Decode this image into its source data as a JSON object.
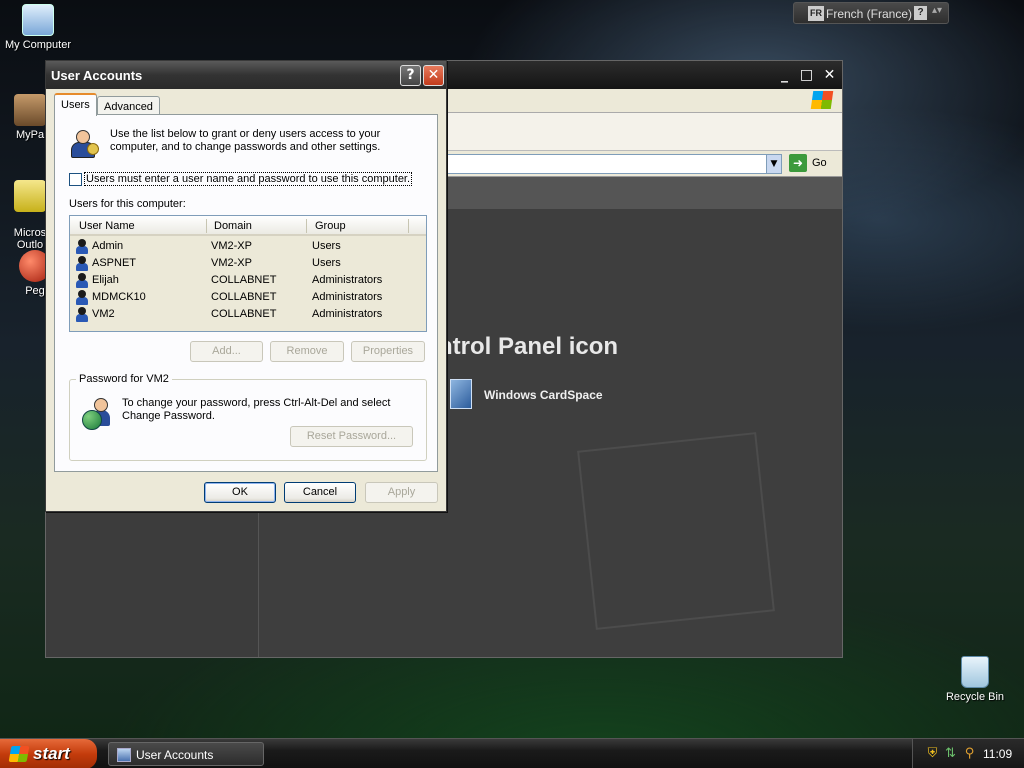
{
  "desktop": {
    "icons": [
      {
        "label": "My Computer"
      },
      {
        "label": "MyPa"
      },
      {
        "label": "Micros\nOutlo"
      },
      {
        "label": "Peg"
      }
    ],
    "recycle_bin": "Recycle Bin"
  },
  "language_bar": {
    "code": "FR",
    "language": "French (France)",
    "help": "?"
  },
  "control_panel": {
    "go_label": "Go",
    "heading": "ntrol Panel icon",
    "item": "Windows CardSpace"
  },
  "dialog": {
    "title": "User Accounts",
    "help_button": "?",
    "close_button": "✕",
    "tabs": [
      "Users",
      "Advanced"
    ],
    "intro": "Use the list below to grant or deny users access to your computer, and to change passwords and other settings.",
    "checkbox_label": "Users must enter a user name and password to use this computer.",
    "checkbox_checked": false,
    "list_label": "Users for this computer:",
    "columns": [
      "User Name",
      "Domain",
      "Group"
    ],
    "rows": [
      {
        "name": "Admin",
        "domain": "VM2-XP",
        "group": "Users"
      },
      {
        "name": "ASPNET",
        "domain": "VM2-XP",
        "group": "Users"
      },
      {
        "name": "Elijah",
        "domain": "COLLABNET",
        "group": "Administrators"
      },
      {
        "name": "MDMCK10",
        "domain": "COLLABNET",
        "group": "Administrators"
      },
      {
        "name": "VM2",
        "domain": "COLLABNET",
        "group": "Administrators"
      }
    ],
    "buttons": {
      "add": "Add...",
      "remove": "Remove",
      "properties": "Properties"
    },
    "password_group": {
      "title": "Password for VM2",
      "text": "To change your password, press Ctrl-Alt-Del and select Change Password.",
      "reset_button": "Reset Password..."
    },
    "footer": {
      "ok": "OK",
      "cancel": "Cancel",
      "apply": "Apply"
    }
  },
  "taskbar": {
    "start_label": "start",
    "task": "User Accounts",
    "clock": "11:09"
  }
}
